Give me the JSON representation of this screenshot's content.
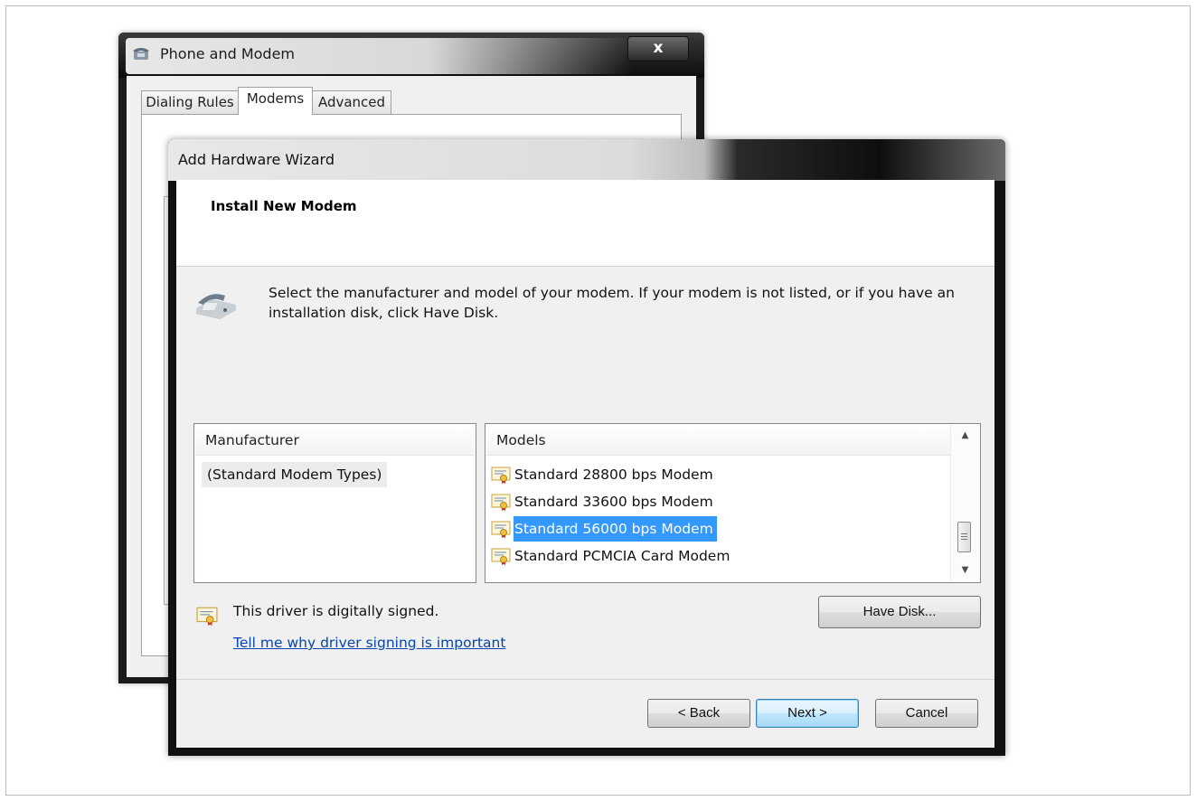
{
  "back_window": {
    "title": "Phone and Modem",
    "close_label": "x",
    "tabs": [
      "Dialing Rules",
      "Modems",
      "Advanced"
    ],
    "active_tab": "Modems"
  },
  "wizard": {
    "title": "Add Hardware Wizard",
    "heading": "Install New Modem",
    "instruction": "Select the manufacturer and model of your modem. If your modem is not listed, or if you have an installation disk, click Have Disk.",
    "manufacturer_header": "Manufacturer",
    "manufacturers": [
      "(Standard Modem Types)"
    ],
    "models_header": "Models",
    "models": [
      "Standard 28800 bps Modem",
      "Standard 33600 bps Modem",
      "Standard 56000 bps Modem",
      "Standard PCMCIA Card Modem"
    ],
    "selected_model": "Standard 56000 bps Modem",
    "signed_text": "This driver is digitally signed.",
    "signing_link": "Tell me why driver signing is important",
    "have_disk_label": "Have Disk...",
    "back_label": "< Back",
    "next_label": "Next >",
    "cancel_label": "Cancel"
  },
  "colors": {
    "selection": "#3399ff",
    "link": "#0645ad",
    "dialog_bg": "#f0f0f0"
  }
}
